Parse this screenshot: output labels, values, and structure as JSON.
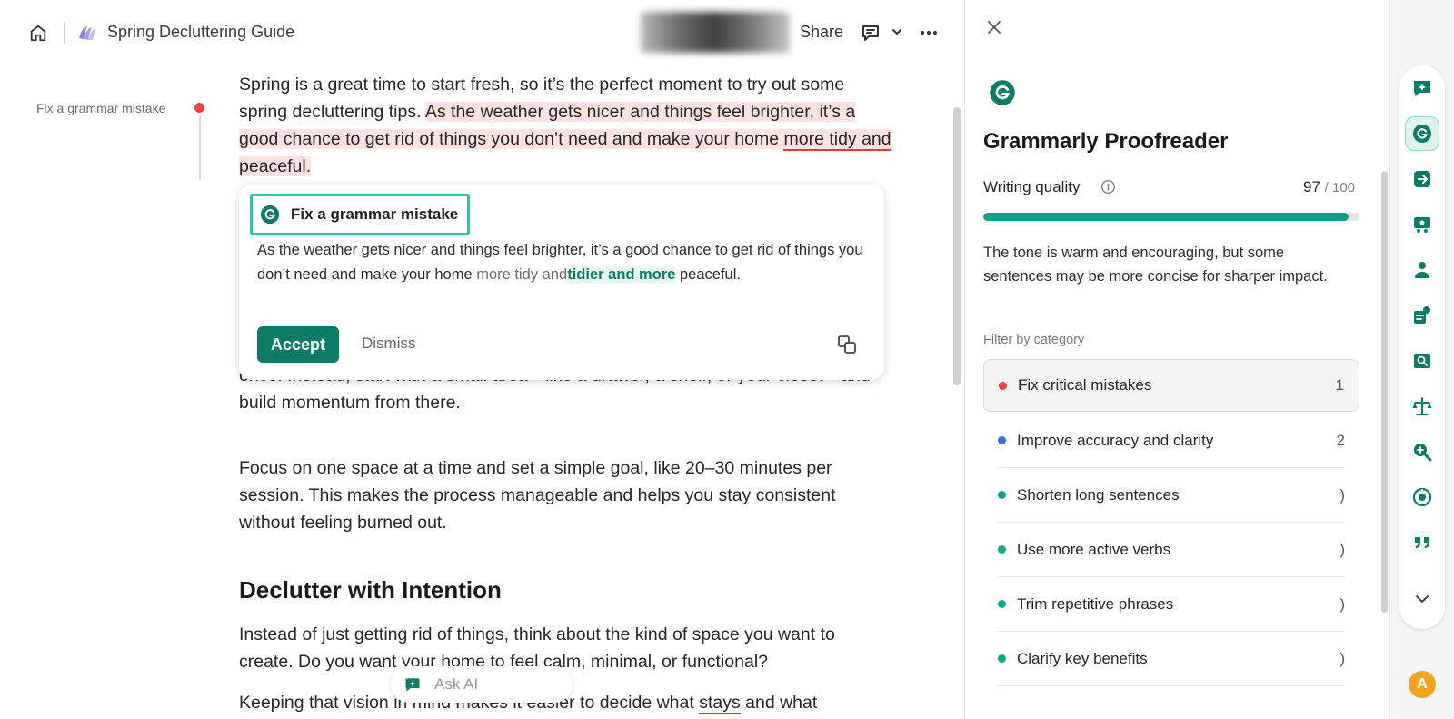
{
  "header": {
    "doc_title": "Spring Decluttering Guide",
    "share_label": "Share"
  },
  "margin": {
    "issue_label": "Fix a grammar mistake"
  },
  "document": {
    "p1_a": "Spring is a great time to start fresh, so it’s the perfect moment to try out some spring decluttering tips. ",
    "p1_hl_a": "As the weather gets nicer and things feel brighter, it’s a good chance to get rid of things you don’t need and make your home ",
    "p1_hl_err": "more tidy and",
    "p1_hl_b": " peaceful.",
    "p2": "once. Instead, start with a small area—like a drawer, a shelf, or your closet—and build momentum from there.",
    "p3": "Focus on one space at a time and set a simple goal, like 20–30 minutes per session. This makes the process manageable and helps you stay consistent without feeling burned out.",
    "heading": "Declutter with Intention",
    "p4": "Instead of just getting rid of things, think about the kind of space you want to create. Do you want your home to feel calm, minimal, or functional?",
    "p5_a": "Keeping that vision in mind makes it easier to decide what ",
    "p5_flag": "stays",
    "p5_b": " and what"
  },
  "suggestion": {
    "title": "Fix a grammar mistake",
    "body_a": "As the weather gets nicer and things feel brighter, it’s a good chance to get rid of things you don’t need and make your home ",
    "removed": "more tidy and",
    "inserted": "tidier and more",
    "body_b": " peaceful.",
    "accept_label": "Accept",
    "dismiss_label": "Dismiss"
  },
  "ask_ai": {
    "label": "Ask AI"
  },
  "panel": {
    "title": "Grammarly Proofreader",
    "quality_label": "Writing quality",
    "quality_score": "97",
    "quality_max": "/ 100",
    "quality_fraction": 0.97,
    "tone_text": "The tone is warm and encouraging, but some sentences may be more concise for sharper impact.",
    "filter_label": "Filter by category",
    "categories": [
      {
        "label": "Fix critical mistakes",
        "count": "1",
        "color": "#ef4444"
      },
      {
        "label": "Improve accuracy and clarity",
        "count": "2",
        "color": "#3b6be0"
      },
      {
        "label": "Shorten long sentences",
        "count": ")",
        "color": "#14a38b"
      },
      {
        "label": "Use more active verbs",
        "count": ")",
        "color": "#14a38b"
      },
      {
        "label": "Trim repetitive phrases",
        "count": ")",
        "color": "#14a38b"
      },
      {
        "label": "Clarify key benefits",
        "count": ")",
        "color": "#14a38b"
      }
    ]
  },
  "rail": {
    "user_initial": "A",
    "icons": [
      "chat-sparkle-icon",
      "grammarly-g-icon",
      "rewrite-icon",
      "audience-icon",
      "persona-icon",
      "reader-reactions-icon",
      "proof-reading-icon",
      "balance-scale-icon",
      "search-plus-icon",
      "ai-detector-icon",
      "quote-icon",
      "chevron-down-icon"
    ]
  },
  "colors": {
    "accent": "#0d7c66",
    "highlight": "#fde2e2",
    "error": "#e53935"
  }
}
